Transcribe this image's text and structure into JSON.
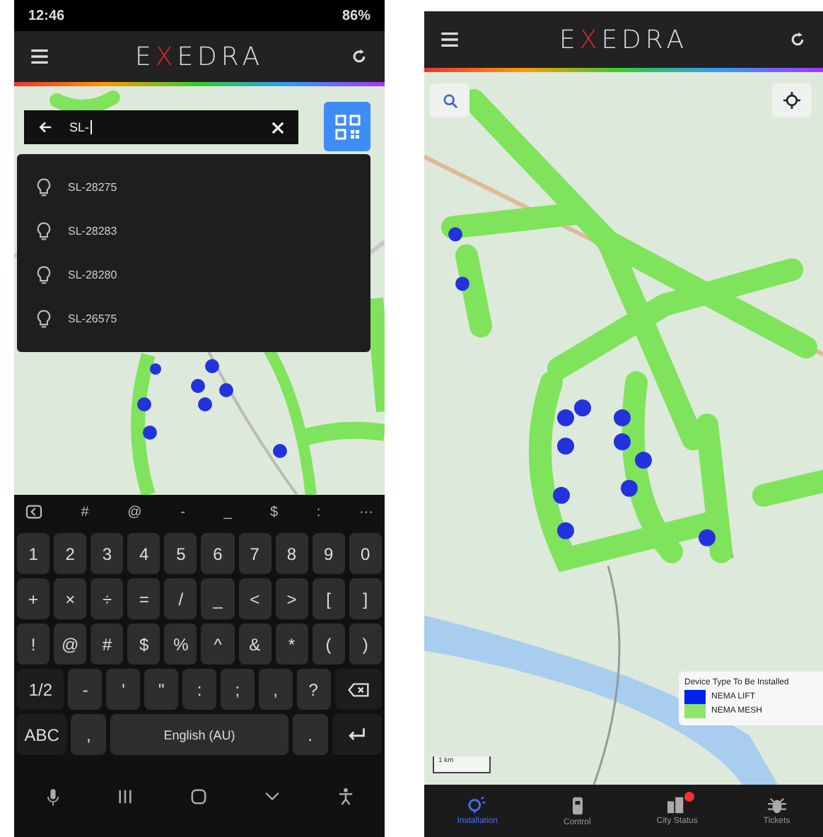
{
  "search_screen": {
    "status_bar": {
      "time": "12:46",
      "battery": "86%"
    },
    "header": {
      "logo": {
        "prefix": "E",
        "accent": "X",
        "suffix": "EDRA"
      }
    },
    "search": {
      "value": "SL-"
    },
    "suggestions": [
      {
        "label": "SL-28275"
      },
      {
        "label": "SL-28283"
      },
      {
        "label": "SL-28280"
      },
      {
        "label": "SL-26575"
      }
    ],
    "keyboard": {
      "toolbar": [
        "#",
        "@",
        "-",
        "_",
        "$",
        ":",
        "···"
      ],
      "key_rows": [
        {
          "keys": [
            {
              "kind": "char",
              "label": "1"
            },
            {
              "kind": "char",
              "label": "2"
            },
            {
              "kind": "char",
              "label": "3"
            },
            {
              "kind": "char",
              "label": "4"
            },
            {
              "kind": "char",
              "label": "5"
            },
            {
              "kind": "char",
              "label": "6"
            },
            {
              "kind": "char",
              "label": "7"
            },
            {
              "kind": "char",
              "label": "8"
            },
            {
              "kind": "char",
              "label": "9"
            },
            {
              "kind": "char",
              "label": "0"
            }
          ]
        },
        {
          "keys": [
            {
              "kind": "char",
              "label": "+"
            },
            {
              "kind": "char",
              "label": "×"
            },
            {
              "kind": "char",
              "label": "÷"
            },
            {
              "kind": "char",
              "label": "="
            },
            {
              "kind": "char",
              "label": "/"
            },
            {
              "kind": "char",
              "label": "_"
            },
            {
              "kind": "char",
              "label": "<"
            },
            {
              "kind": "char",
              "label": ">"
            },
            {
              "kind": "char",
              "label": "["
            },
            {
              "kind": "char",
              "label": "]"
            }
          ]
        },
        {
          "keys": [
            {
              "kind": "char",
              "label": "!"
            },
            {
              "kind": "char",
              "label": "@"
            },
            {
              "kind": "char",
              "label": "#"
            },
            {
              "kind": "char",
              "label": "$"
            },
            {
              "kind": "char",
              "label": "%"
            },
            {
              "kind": "char",
              "label": "^"
            },
            {
              "kind": "char",
              "label": "&"
            },
            {
              "kind": "char",
              "label": "*"
            },
            {
              "kind": "char",
              "label": "("
            },
            {
              "kind": "char",
              "label": ")"
            }
          ]
        },
        {
          "keys": [
            {
              "kind": "mode",
              "label": "1/2"
            },
            {
              "kind": "char",
              "label": "-"
            },
            {
              "kind": "char",
              "label": "'"
            },
            {
              "kind": "char",
              "label": "\""
            },
            {
              "kind": "char",
              "label": ":"
            },
            {
              "kind": "char",
              "label": ";"
            },
            {
              "kind": "char",
              "label": ","
            },
            {
              "kind": "char",
              "label": "?"
            },
            {
              "kind": "backspace"
            }
          ]
        },
        {
          "keys": [
            {
              "kind": "mode",
              "label": "ABC"
            },
            {
              "kind": "char",
              "label": ","
            },
            {
              "kind": "space",
              "label": "English (AU)"
            },
            {
              "kind": "char",
              "label": "."
            },
            {
              "kind": "enter"
            }
          ]
        }
      ]
    }
  },
  "map_screen": {
    "header": {
      "logo": {
        "prefix": "E",
        "accent": "X",
        "suffix": "EDRA"
      }
    },
    "legend": {
      "title": "Device Type To Be Installed",
      "items": [
        {
          "label": "NEMA LIFT",
          "color": "#0022ee"
        },
        {
          "label": "NEMA MESH",
          "color": "#8ee66a"
        }
      ]
    },
    "scale": "1 km",
    "nav": [
      {
        "kind": "bulb",
        "label": "Installation",
        "selected": true,
        "badge": false
      },
      {
        "kind": "remote",
        "label": "Control",
        "selected": false,
        "badge": false
      },
      {
        "kind": "city",
        "label": "City Status",
        "selected": false,
        "badge": true
      },
      {
        "kind": "bug",
        "label": "Tickets",
        "selected": false,
        "badge": false
      }
    ]
  }
}
